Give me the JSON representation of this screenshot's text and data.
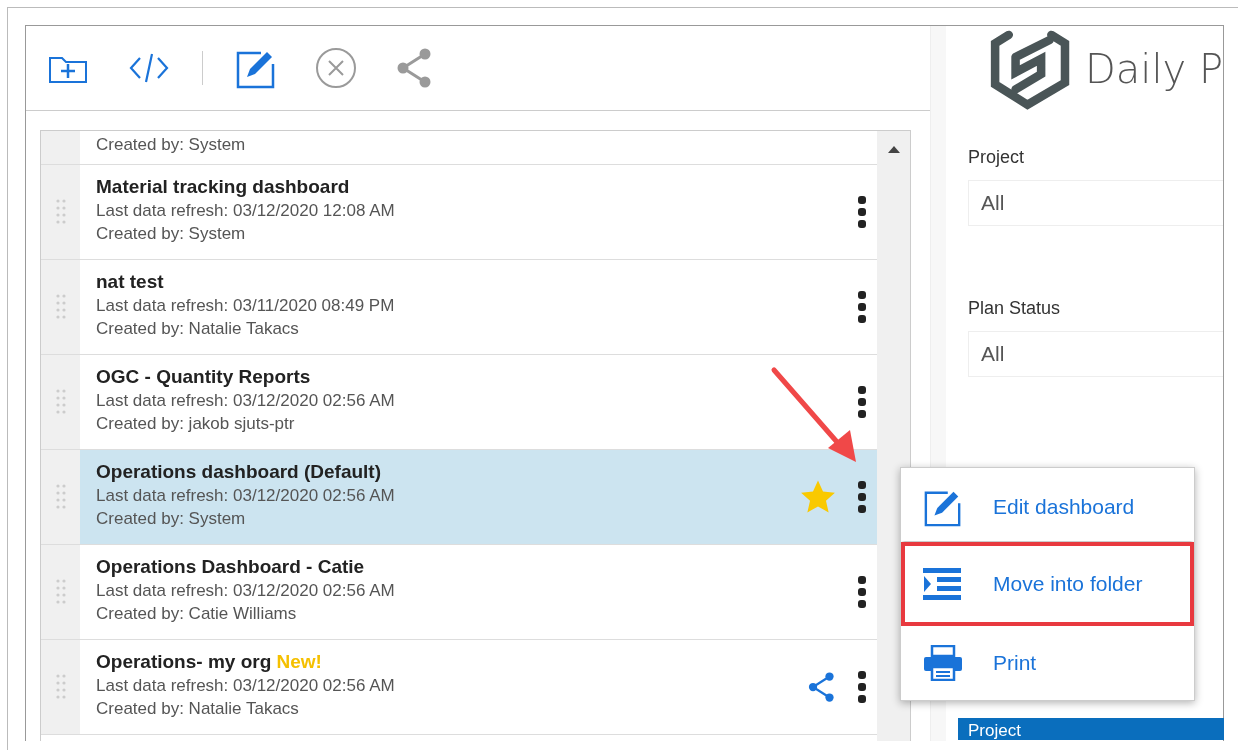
{
  "toolbar": [
    {
      "kind": "add-folder",
      "disabled": false
    },
    {
      "kind": "code",
      "disabled": false
    },
    {
      "kind": "divider"
    },
    {
      "kind": "edit",
      "disabled": false
    },
    {
      "kind": "cancel",
      "disabled": true
    },
    {
      "kind": "share",
      "disabled": true
    }
  ],
  "dashboards": [
    {
      "created_by": "Created by: System",
      "partial": true,
      "selected": false
    },
    {
      "title": "Material tracking dashboard",
      "refresh": "Last data refresh: 03/12/2020 12:08 AM",
      "created_by": "Created by: System",
      "selected": false,
      "starred": false,
      "shared": false
    },
    {
      "title": "nat test",
      "refresh": "Last data refresh: 03/11/2020 08:49 PM",
      "created_by": "Created by: Natalie Takacs",
      "selected": false,
      "starred": false,
      "shared": false
    },
    {
      "title": "OGC - Quantity Reports",
      "refresh": "Last data refresh: 03/12/2020 02:56 AM",
      "created_by": "Created by: jakob sjuts-ptr",
      "selected": false,
      "starred": false,
      "shared": false
    },
    {
      "title": "Operations dashboard (Default)",
      "refresh": "Last data refresh: 03/12/2020 02:56 AM",
      "created_by": "Created by: System",
      "selected": true,
      "starred": true,
      "shared": false
    },
    {
      "title": "Operations Dashboard - Catie",
      "refresh": "Last data refresh: 03/12/2020 02:56 AM",
      "created_by": "Created by: Catie Williams",
      "selected": false,
      "starred": false,
      "shared": false
    },
    {
      "title": "Operations- my org",
      "badge": "New!",
      "refresh": "Last data refresh: 03/12/2020 02:56 AM",
      "created_by": "Created by: Natalie Takacs",
      "selected": false,
      "starred": false,
      "shared": true
    }
  ],
  "report": {
    "title": "Daily P",
    "filters": [
      {
        "label": "Project",
        "value": "All"
      },
      {
        "label": "Plan Status",
        "value": "All"
      }
    ],
    "table_header": "Project"
  },
  "context_menu": [
    {
      "kind": "edit",
      "label": "Edit dashboard",
      "highlighted": false
    },
    {
      "kind": "move",
      "label": "Move into folder",
      "highlighted": true
    },
    {
      "kind": "print",
      "label": "Print",
      "highlighted": false
    }
  ]
}
